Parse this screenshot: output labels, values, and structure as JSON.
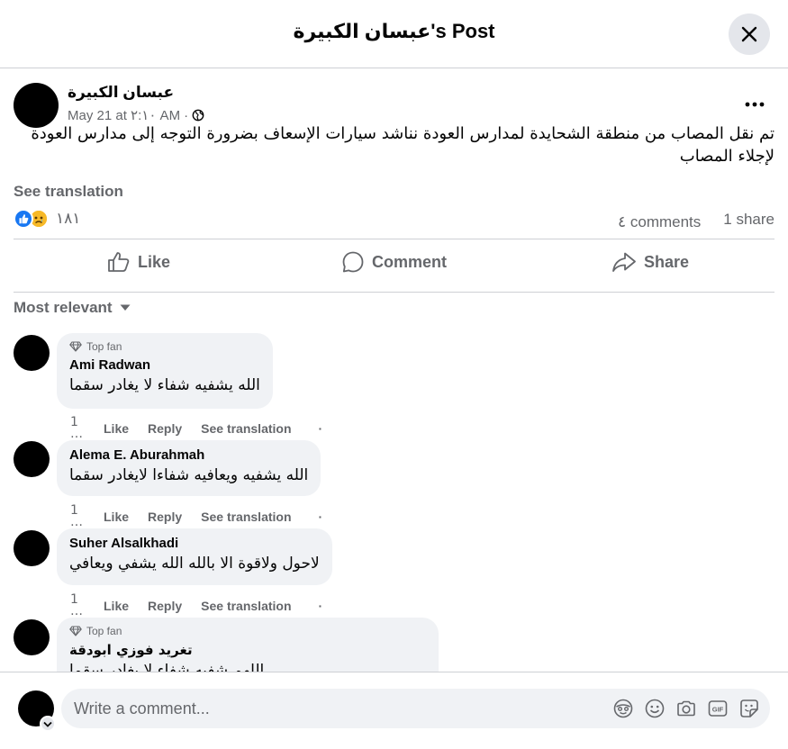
{
  "header": {
    "title": "عبسان الكبيرة's Post"
  },
  "post": {
    "author": "عبسان الكبيرة",
    "date": "May 21 at ٢:١٠ AM",
    "date_separator": "·",
    "text": "تم نقل المصاب من منطقة الشحايدة لمدارس العودة نناشد سيارات الإسعاف بضرورة التوجه إلى مدارس العودة لإجلاء المصاب",
    "see_translation": "See translation",
    "reactions_count": "١٨١",
    "comments_count": "٤ comments",
    "shares_count": "1 share"
  },
  "actions": {
    "like": "Like",
    "comment": "Comment",
    "share": "Share"
  },
  "sort": {
    "label": "Most relevant"
  },
  "comments": [
    {
      "badge": "Top fan",
      "author": "Ami Radwan",
      "text": "الله يشفيه شفاء لا يغادر سقما",
      "time": "1 …",
      "like": "Like",
      "reply": "Reply",
      "translate": "See translation",
      "dot": "·"
    },
    {
      "badge": "",
      "author": "Alema E. Aburahmah",
      "text": "الله يشفيه ويعافيه شفاءا لايغادر سقما",
      "time": "1 …",
      "like": "Like",
      "reply": "Reply",
      "translate": "See translation",
      "dot": "·"
    },
    {
      "badge": "",
      "author": "Suher Alsalkhadi",
      "text": "لاحول ولاقوة الا بالله الله يشفي ويعافي",
      "time": "1 …",
      "like": "Like",
      "reply": "Reply",
      "translate": "See translation",
      "dot": "·"
    },
    {
      "badge": "Top fan",
      "author": "تغريد فوزي ابودقة",
      "text": "اللهم شفيه شفاء لا يغادر سقما",
      "time": "",
      "like": "",
      "reply": "",
      "translate": "",
      "dot": ""
    }
  ],
  "composer": {
    "placeholder": "Write a comment..."
  },
  "icons": [
    "close-icon",
    "more-icon",
    "globe-icon",
    "like-reaction-icon",
    "sad-reaction-icon",
    "like-icon",
    "comment-icon",
    "share-icon",
    "caret-down-icon",
    "diamond-icon",
    "avatar-emoji-icon",
    "emoji-icon",
    "camera-icon",
    "gif-icon",
    "sticker-icon"
  ],
  "colors": {
    "accent": "#1877f2",
    "muted": "#65676b",
    "bubble": "#f0f2f5",
    "sad": "#f7b928"
  }
}
